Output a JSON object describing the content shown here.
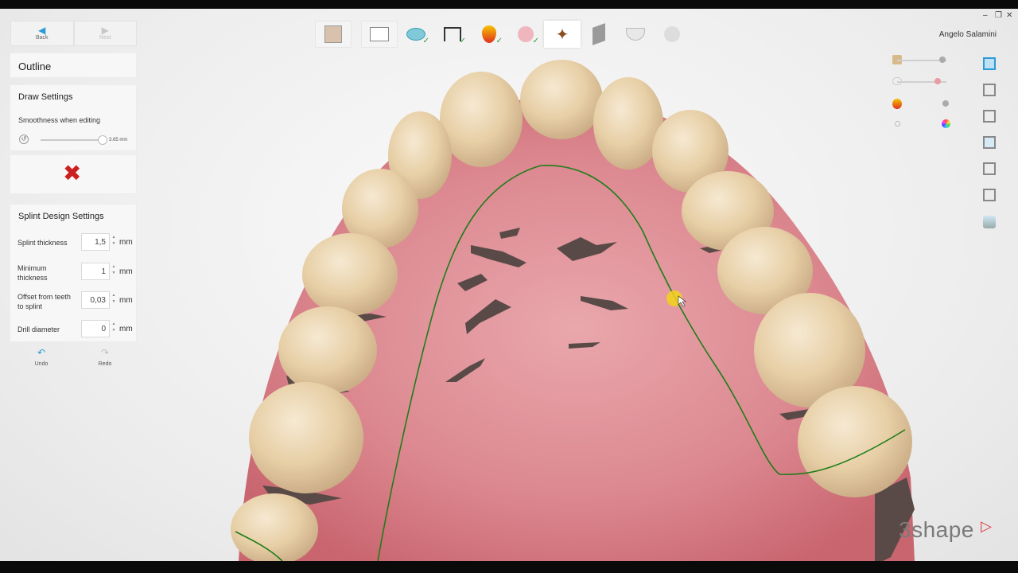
{
  "app": {
    "brand": "3shape",
    "user_name": "Angelo Salamini"
  },
  "navigation": {
    "back_label": "Back",
    "next_label": "Next"
  },
  "outline_panel": {
    "title": "Outline"
  },
  "draw_settings": {
    "title": "Draw Settings",
    "smoothness_label": "Smoothness when editing",
    "smoothness_value": "3.65 mm",
    "smoothness_fraction": 0.98
  },
  "splint_settings": {
    "title": "Splint Design Settings",
    "fields": [
      {
        "label": "Splint thickness",
        "value": "1,5",
        "unit": "mm"
      },
      {
        "label": "Minimum thickness",
        "value": "1",
        "unit": "mm"
      },
      {
        "label": "Offset from teeth to splint",
        "value": "0,03",
        "unit": "mm"
      },
      {
        "label": "Drill diameter",
        "value": "0",
        "unit": "mm"
      }
    ]
  },
  "history": {
    "undo_label": "Undo",
    "redo_label": "Redo"
  },
  "toolbar": {
    "tools": [
      {
        "icon": "patient-photo-icon",
        "completed": false
      },
      {
        "icon": "order-form-icon",
        "completed": false
      },
      {
        "icon": "insertion-direction-icon",
        "completed": true
      },
      {
        "icon": "model-trim-icon",
        "completed": true
      },
      {
        "icon": "blockout-icon",
        "completed": true
      },
      {
        "icon": "splint-shape-icon",
        "completed": true
      },
      {
        "icon": "outline-spline-icon",
        "completed": false,
        "active": true
      },
      {
        "icon": "sculpt-icon",
        "completed": false
      },
      {
        "icon": "splint-finish-icon",
        "completed": false
      },
      {
        "icon": "output-icon",
        "completed": false
      }
    ]
  },
  "visibility": {
    "sliders": [
      {
        "icon": "scan-model-icon",
        "level": 0.92
      },
      {
        "icon": "antagonist-icon",
        "level": 0.82
      }
    ],
    "toggles": [
      {
        "icon": "blockout-visibility-icon"
      },
      {
        "icon": "color-texture-icon"
      }
    ]
  },
  "colors": {
    "accent_blue": "#2d9bd6",
    "check_green": "#2e9e3c",
    "cancel_red": "#cc1f1f",
    "outline_green": "#1f7d1a",
    "gum_pink": "#d97f86"
  }
}
